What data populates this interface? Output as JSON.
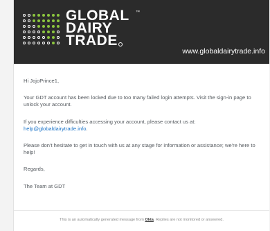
{
  "brand": {
    "logo_line1": "GLOBAL",
    "logo_line2": "DAIRY",
    "logo_line3": "TRADE",
    "trademark": "™",
    "website": "www.globaldairytrade.info"
  },
  "email": {
    "greeting": "Hi JojoPrince1,",
    "locked_message": "Your GDT account has been locked due to too many failed login attempts. Visit the sign-in page to unlock your account.",
    "help_message": "If you experience difficulties accessing your account, please contact us at:",
    "help_email": "help@globaldairytrade.info",
    "help_email_suffix": ".",
    "contact_message": "Please don't hesitate to get in touch with us at any stage for information or assistance; we're here to help!",
    "closing": "Regards,",
    "signature": "The Team at GDT"
  },
  "footer": {
    "prefix": "This is an automatically generated message from ",
    "okta_link": "Okta",
    "suffix": ". Replies are not monitored or answered."
  },
  "colors": {
    "header_bg": "#2b2b2b",
    "dot_green": "#8cc63f",
    "dot_white": "#ffffff",
    "link": "#1a73c8"
  }
}
